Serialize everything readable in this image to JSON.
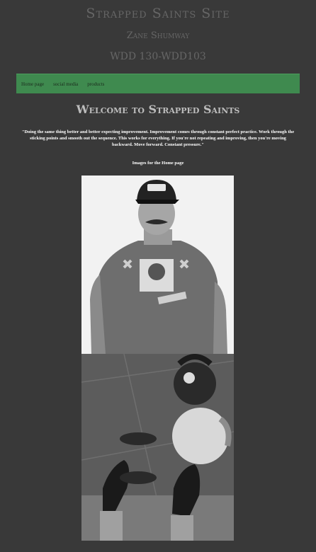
{
  "header": {
    "site_title": "Strapped Saints Site",
    "author": "Zane Shumway",
    "course": "WDD 130-WDD103"
  },
  "nav": {
    "items": [
      "Home page",
      "social media",
      "products"
    ],
    "bg_color": "#3f8a4f"
  },
  "main": {
    "welcome": "Welcome to Strapped Saints",
    "quote": "\"Doing the same thing better and better expecting improvement. Improvement comes through constant perfect practice. Work through the sticking points and smooth out the sequence. This works for everything. If you're not repeating and improving, then you're moving backward. Move forward. Constant pressure.\"",
    "images_label": "Images for the Home page"
  },
  "photos": [
    {
      "name": "man-portrait-photo",
      "subject": "man in cap and graphic t-shirt"
    },
    {
      "name": "kettlebells-photo",
      "subject": "feet with kettlebells on floor"
    }
  ]
}
